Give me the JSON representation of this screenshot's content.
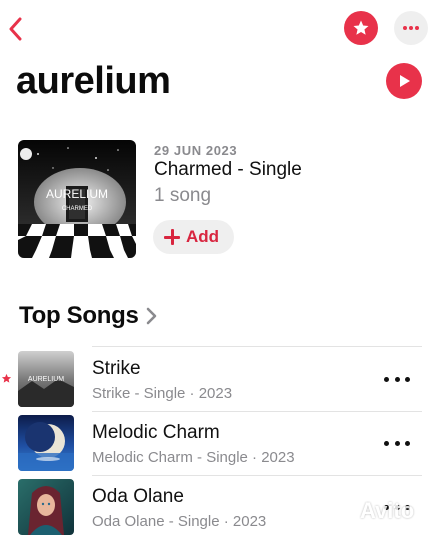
{
  "header": {
    "back_icon": "chevron-left-icon",
    "favorite_icon": "star-icon",
    "more_icon": "ellipsis-icon",
    "accent_color": "#e8324a"
  },
  "artist": {
    "name": "aurelium",
    "play_icon": "play-icon"
  },
  "latest_release": {
    "date": "29 JUN 2023",
    "title": "Charmed - Single",
    "track_count": "1 song",
    "add_label": "Add",
    "artwork_text": "AURELIUM",
    "artwork_subtext": "CHARMED"
  },
  "top_songs": {
    "title": "Top Songs",
    "songs": [
      {
        "title": "Strike",
        "subtitle": "Strike - Single · 2023",
        "favorited": true,
        "artwork_text": "AURELIUM"
      },
      {
        "title": "Melodic Charm",
        "subtitle": "Melodic Charm - Single · 2023",
        "favorited": false
      },
      {
        "title": "Oda Olane",
        "subtitle": "Oda Olane - Single · 2023",
        "favorited": false
      }
    ]
  },
  "watermark": {
    "text": "Avito"
  }
}
